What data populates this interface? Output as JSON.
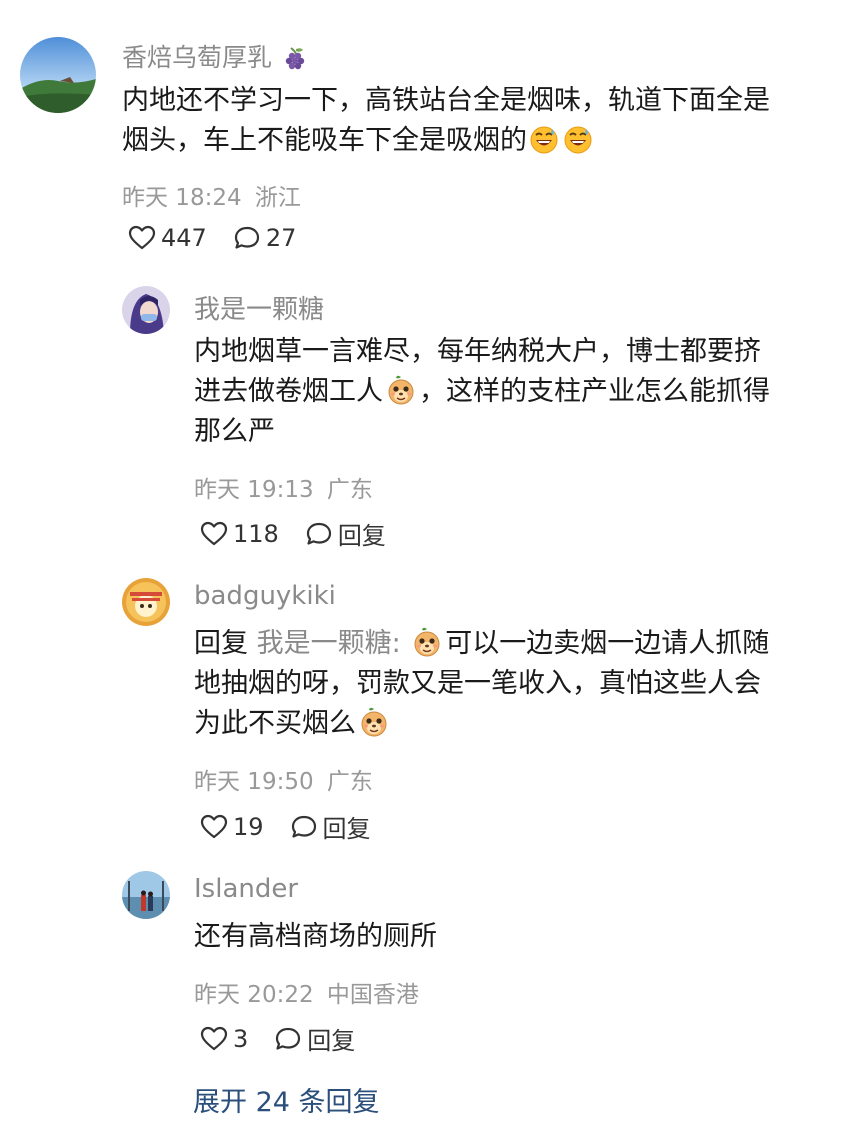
{
  "comments": [
    {
      "username": "香焙乌萄厚乳",
      "name_icon": "grape-icon",
      "text_lines": [
        "内地还不学习一下，高铁站台全是烟味，轨道下面全是",
        "烟头，车上不能吸车下全是吸烟的"
      ],
      "emojis": [
        "grin-sweat-emoji",
        "grin-sweat-emoji"
      ],
      "time": "昨天 18:24",
      "location": "浙江",
      "likes": "447",
      "reply_count": "27"
    }
  ],
  "replies": [
    {
      "username": "我是一颗糖",
      "text_lines": [
        "内地烟草一言难尽，每年纳税大户，博士都要挤",
        "进去做卷烟工人",
        "，这样的支柱产业怎么能抓得",
        "那么严"
      ],
      "emoji": "meerkat-emoji",
      "time": "昨天 19:13",
      "location": "广东",
      "likes": "118",
      "reply_label": "回复"
    },
    {
      "username": "badguykiki",
      "reply_prefix": "回复",
      "reply_target": "我是一颗糖:",
      "text_lines": [
        "可以一边卖烟一边请人抓随",
        "地抽烟的呀，罚款又是一笔收入，真怕这些人会",
        "为此不买烟么"
      ],
      "emoji": "meerkat-emoji",
      "time": "昨天 19:50",
      "location": "广东",
      "likes": "19",
      "reply_label": "回复"
    },
    {
      "username": "Islander",
      "text_lines": [
        "还有高档商场的厕所"
      ],
      "time": "昨天 20:22",
      "location": "中国香港",
      "likes": "3",
      "reply_label": "回复"
    }
  ],
  "expand": {
    "label": "展开 24 条回复"
  },
  "colors": {
    "username": "#8a8a8a",
    "meta": "#999999",
    "link": "#2b4f7a",
    "text": "#1a1a1a"
  }
}
